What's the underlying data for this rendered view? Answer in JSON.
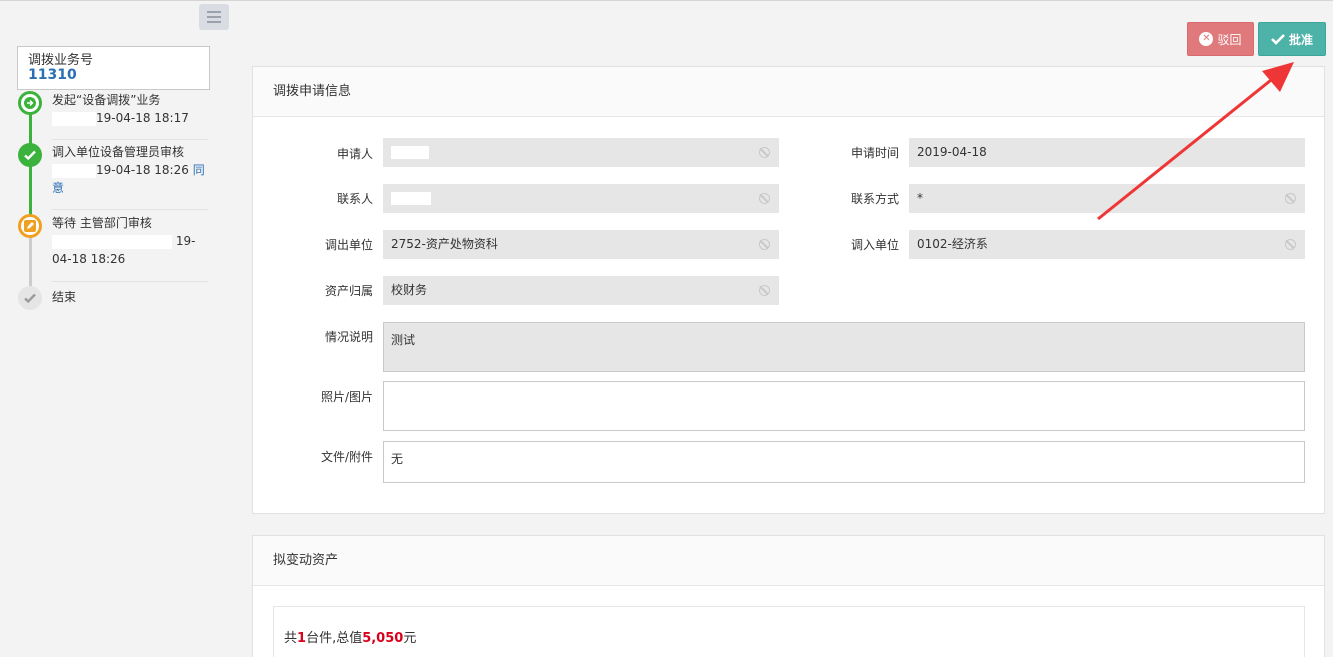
{
  "biz": {
    "label": "调拨业务号",
    "number": "11310"
  },
  "timeline": [
    {
      "title": "发起“设备调拨”业务",
      "time": "19-04-18 18:17",
      "note": "",
      "status": "done-arrow"
    },
    {
      "title": "调入单位设备管理员审核",
      "time": "19-04-18 18:26",
      "note": "同意",
      "status": "done-check"
    },
    {
      "title": "等待 主管部门审核",
      "time_part1": "19-",
      "time_part2": "04-18 18:26",
      "status": "pending"
    },
    {
      "title": "结束",
      "status": "end"
    }
  ],
  "actions": {
    "reject": "驳回",
    "approve": "批准"
  },
  "apply_panel": {
    "title": "调拨申请信息",
    "fields": {
      "applicant_label": "申请人",
      "applicant_value": "",
      "apply_time_label": "申请时间",
      "apply_time_value": "2019-04-18",
      "contact_label": "联系人",
      "contact_value": "",
      "contact_way_label": "联系方式",
      "contact_way_value": "*",
      "out_unit_label": "调出单位",
      "out_unit_value": "2752-资产处物资科",
      "in_unit_label": "调入单位",
      "in_unit_value": "0102-经济系",
      "ownership_label": "资产归属",
      "ownership_value": "校财务",
      "desc_label": "情况说明",
      "desc_value": "测试",
      "photo_label": "照片/图片",
      "photo_value": "",
      "file_label": "文件/附件",
      "file_value": "无"
    }
  },
  "assets_panel": {
    "title": "拟变动资产",
    "total_prefix": "共",
    "count": "1",
    "count_unit": "台件,总值",
    "value": "5,050",
    "value_unit": "元"
  },
  "colors": {
    "approve": "#4db3a8",
    "reject": "#e0797b",
    "done": "#3bb23b",
    "pending": "#f0a020",
    "link": "#2a6fb5"
  }
}
